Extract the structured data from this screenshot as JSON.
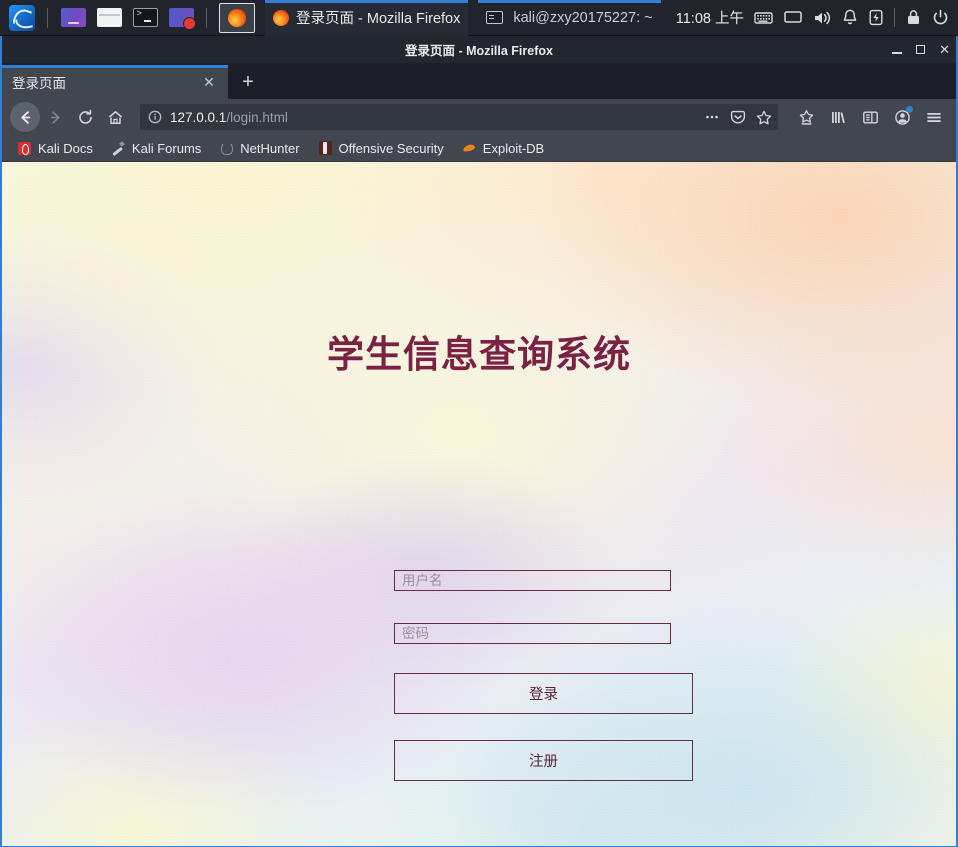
{
  "taskbar": {
    "launchers": [
      {
        "name": "kali-menu",
        "icon": "kali-dragon-icon"
      },
      {
        "name": "app-launcher",
        "icon": "apps-icon"
      },
      {
        "name": "file-manager",
        "icon": "folder-icon"
      },
      {
        "name": "terminal",
        "icon": "terminal-icon"
      },
      {
        "name": "screen-recorder",
        "icon": "screen-record-icon"
      },
      {
        "name": "firefox",
        "icon": "firefox-icon"
      }
    ],
    "window_button": {
      "title": "登录页面 - Mozilla Firefox",
      "icon": "firefox-icon"
    },
    "terminal_task": {
      "title": "kali@zxy20175227: ~",
      "icon": "terminal-icon"
    },
    "clock": "11:08 上午",
    "tray": [
      {
        "name": "keyboard-layout-icon"
      },
      {
        "name": "display-icon"
      },
      {
        "name": "volume-icon"
      },
      {
        "name": "notification-bell-icon"
      },
      {
        "name": "battery-icon"
      },
      {
        "name": "lock-screen-icon"
      },
      {
        "name": "logout-icon"
      }
    ]
  },
  "window": {
    "title": "登录页面 - Mozilla Firefox",
    "minimize_label": "Minimize",
    "maximize_label": "Maximize",
    "close_label": "✕",
    "accent_color": "#2f7fd6",
    "titlebar_color": "#22262e"
  },
  "tabs": [
    {
      "label": "登录页面",
      "close": "✕",
      "active": true
    }
  ],
  "newtab_label": "+",
  "toolbar": {
    "back_label": "←",
    "forward_label": "→",
    "reload_label": "⟳",
    "home_label": "⌂",
    "url": {
      "host": "127.0.0.1",
      "path": "/login.html",
      "identity_icon": "info-circle-icon",
      "page_actions_label": "···",
      "pocket_label": "save-to-pocket-icon",
      "bookmark_label": "star-icon"
    },
    "right_icons": [
      {
        "name": "downloads-icon"
      },
      {
        "name": "library-icon"
      },
      {
        "name": "sidebar-icon"
      },
      {
        "name": "account-icon"
      },
      {
        "name": "menu-icon"
      }
    ]
  },
  "bookmarks": [
    {
      "label": "Kali Docs",
      "icon": "kali-docs-icon"
    },
    {
      "label": "Kali Forums",
      "icon": "kali-forums-icon"
    },
    {
      "label": "NetHunter",
      "icon": "nethunter-icon"
    },
    {
      "label": "Offensive Security",
      "icon": "offensive-security-icon"
    },
    {
      "label": "Exploit-DB",
      "icon": "exploit-db-icon"
    }
  ],
  "page": {
    "heading": "学生信息查询系统",
    "heading_color": "#7b2143",
    "border_color": "#6b2a3d",
    "username": {
      "value": "",
      "placeholder": "用户名"
    },
    "password": {
      "value": "",
      "placeholder": "密码"
    },
    "login_button": "登录",
    "register_button": "注册"
  }
}
